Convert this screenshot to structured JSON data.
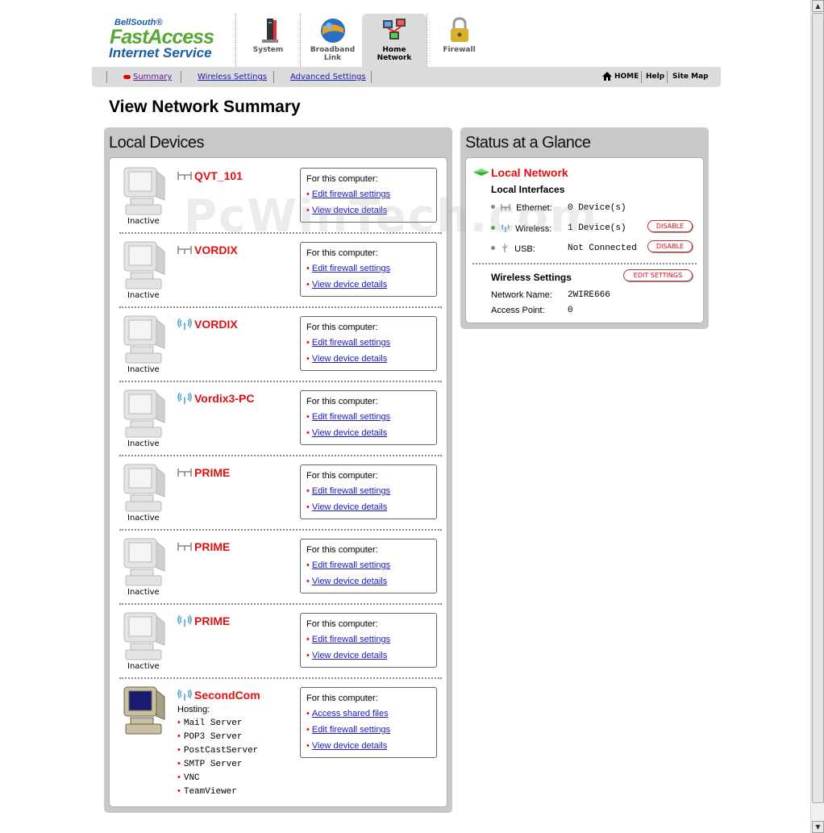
{
  "brand": {
    "top": "BellSouth®",
    "main": "FastAccess",
    "sub": "Internet Service"
  },
  "tabs": [
    {
      "label1": "System",
      "label2": ""
    },
    {
      "label1": "Broadband",
      "label2": "Link"
    },
    {
      "label1": "Home",
      "label2": "Network"
    },
    {
      "label1": "Firewall",
      "label2": ""
    }
  ],
  "subnav": {
    "summary": "Summary",
    "wireless": "Wireless Settings",
    "advanced": "Advanced Settings",
    "home": "HOME",
    "help": "Help",
    "sitemap": "Site Map"
  },
  "page_title": "View Network Summary",
  "watermark": "PcWinTech.com",
  "local_devices": {
    "title": "Local Devices",
    "for_label": "For this computer:",
    "devices": [
      {
        "name": "QVT_101",
        "conn": "wired",
        "status": "Inactive",
        "links": [
          "Edit firewall settings",
          "View device details"
        ]
      },
      {
        "name": "VORDIX",
        "conn": "wired",
        "status": "Inactive",
        "links": [
          "Edit firewall settings",
          "View device details"
        ]
      },
      {
        "name": "VORDIX",
        "conn": "wireless",
        "status": "Inactive",
        "links": [
          "Edit firewall settings",
          "View device details"
        ]
      },
      {
        "name": "Vordix3-PC",
        "conn": "wireless",
        "status": "Inactive",
        "links": [
          "Edit firewall settings",
          "View device details"
        ]
      },
      {
        "name": "PRIME",
        "conn": "wired",
        "status": "Inactive",
        "links": [
          "Edit firewall settings",
          "View device details"
        ]
      },
      {
        "name": "PRIME",
        "conn": "wired",
        "status": "Inactive",
        "links": [
          "Edit firewall settings",
          "View device details"
        ]
      },
      {
        "name": "PRIME",
        "conn": "wireless",
        "status": "Inactive",
        "links": [
          "Edit firewall settings",
          "View device details"
        ]
      },
      {
        "name": "SecondCom",
        "conn": "wireless",
        "status": "",
        "links": [
          "Access shared files",
          "Edit firewall settings",
          "View device details"
        ]
      }
    ],
    "hosting_label": "Hosting:",
    "hosting": [
      "Mail Server",
      "POP3 Server",
      "PostCastServer",
      "SMTP Server",
      "VNC",
      "TeamViewer"
    ]
  },
  "status_glance": {
    "title": "Status at a Glance",
    "local_network": "Local Network",
    "local_interfaces": "Local Interfaces",
    "ethernet_label": "Ethernet:",
    "ethernet_value": "0 Device(s)",
    "wireless_label": "Wireless:",
    "wireless_value": "1 Device(s)",
    "usb_label": "USB:",
    "usb_value": "Not Connected",
    "disable_label": "DISABLE",
    "wireless_settings": "Wireless Settings",
    "edit_settings": "EDIT SETTINGS",
    "network_name_label": "Network Name:",
    "network_name_value": "2WIRE666",
    "access_point_label": "Access Point:",
    "access_point_value": "0"
  },
  "colors": {
    "device_name": "#e01010",
    "link": "#1a1ac0",
    "panel": "#c8c8c8",
    "brand_green": "#55a834",
    "brand_blue": "#1b5ea8"
  }
}
